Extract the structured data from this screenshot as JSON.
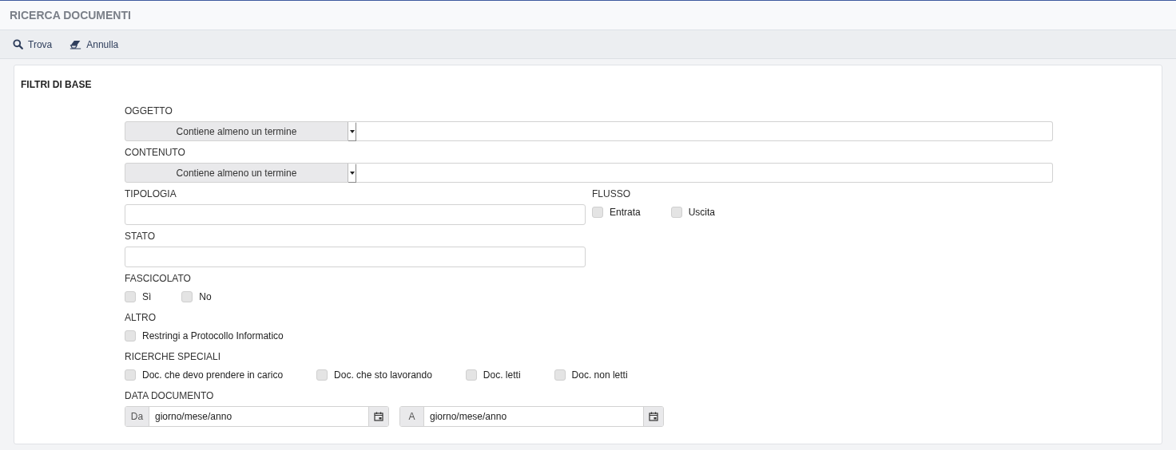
{
  "title": "RICERCA DOCUMENTI",
  "toolbar": [
    {
      "label": "Trova"
    },
    {
      "label": "Annulla"
    }
  ],
  "section": {
    "title": "FILTRI DI BASE",
    "rows": [
      {
        "groups": [
          {
            "kind": "match",
            "label": "OGGETTO",
            "select": "Contiene almeno un termine"
          }
        ]
      },
      {
        "groups": [
          {
            "kind": "match",
            "label": "CONTENUTO",
            "select": "Contiene almeno un termine"
          }
        ]
      },
      {
        "groups": [
          {
            "kind": "text",
            "label": "TIPOLOGIA"
          },
          {
            "kind": "checks",
            "label": "FLUSSO",
            "options": [
              {
                "label": "Entrata",
                "checked": false
              },
              {
                "label": "Uscita",
                "checked": false
              }
            ]
          }
        ]
      },
      {
        "groups": [
          {
            "kind": "text",
            "label": "STATO"
          }
        ]
      },
      {
        "groups": [
          {
            "kind": "checks",
            "label": "FASCICOLATO",
            "options": [
              {
                "label": "Sì",
                "checked": false
              },
              {
                "label": "No",
                "checked": false
              }
            ]
          }
        ]
      },
      {
        "groups": [
          {
            "kind": "checks",
            "label": "ALTRO",
            "options": [
              {
                "label": "Restringi a Protocollo Informatico",
                "checked": false
              }
            ]
          }
        ]
      },
      {
        "groups": [
          {
            "kind": "checks",
            "label": "RICERCHE SPECIALI",
            "options": [
              {
                "label": "Doc. che devo prendere in carico",
                "checked": false
              },
              {
                "label": "Doc. che sto lavorando",
                "checked": false
              },
              {
                "label": "Doc. letti",
                "checked": false
              },
              {
                "label": "Doc. non letti",
                "checked": false
              }
            ]
          }
        ]
      },
      {
        "groups": [
          {
            "kind": "dates",
            "label": "DATA DOCUMENTO",
            "fields": [
              {
                "prefix": "Da",
                "placeholder": "giorno/mese/anno"
              },
              {
                "prefix": "A",
                "placeholder": "giorno/mese/anno"
              }
            ]
          }
        ]
      }
    ]
  }
}
